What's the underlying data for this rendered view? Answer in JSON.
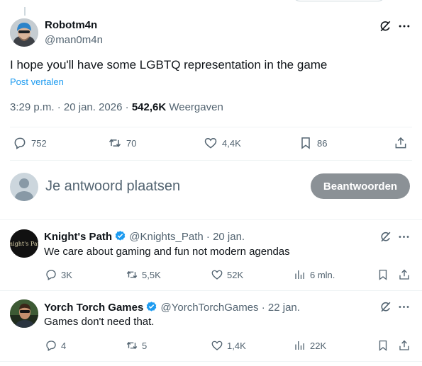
{
  "main_post": {
    "display_name": "Robotm4n",
    "handle": "@man0m4n",
    "text": "I hope you'll have some LGBTQ representation in the game",
    "translate_label": "Post vertalen",
    "time": "3:29 p.m.",
    "date": "20 jan. 2026",
    "views_count": "542,6K",
    "views_label": "Weergaven",
    "replies": "752",
    "reposts": "70",
    "likes": "4,4K",
    "bookmarks": "86"
  },
  "reply_box": {
    "placeholder": "Je antwoord plaatsen",
    "button_label": "Beantwoorden"
  },
  "replies": [
    {
      "display_name": "Knight's Path",
      "verified": true,
      "handle": "@Knights_Path",
      "date": "20 jan.",
      "text": "We care about gaming and fun not modern agendas",
      "replies": "3K",
      "reposts": "5,5K",
      "likes": "52K",
      "views": "6 mln.",
      "avatar_text": "Knight's Path"
    },
    {
      "display_name": "Yorch Torch Games",
      "verified": true,
      "handle": "@YorchTorchGames",
      "date": "22 jan.",
      "text": "Games don't need that.",
      "replies": "4",
      "reposts": "5",
      "likes": "1,4K",
      "views": "22K"
    }
  ],
  "colors": {
    "accent": "#1d9bf0",
    "secondary_text": "#536471",
    "button_bg": "#8b9196",
    "divider": "#eff3f4"
  }
}
